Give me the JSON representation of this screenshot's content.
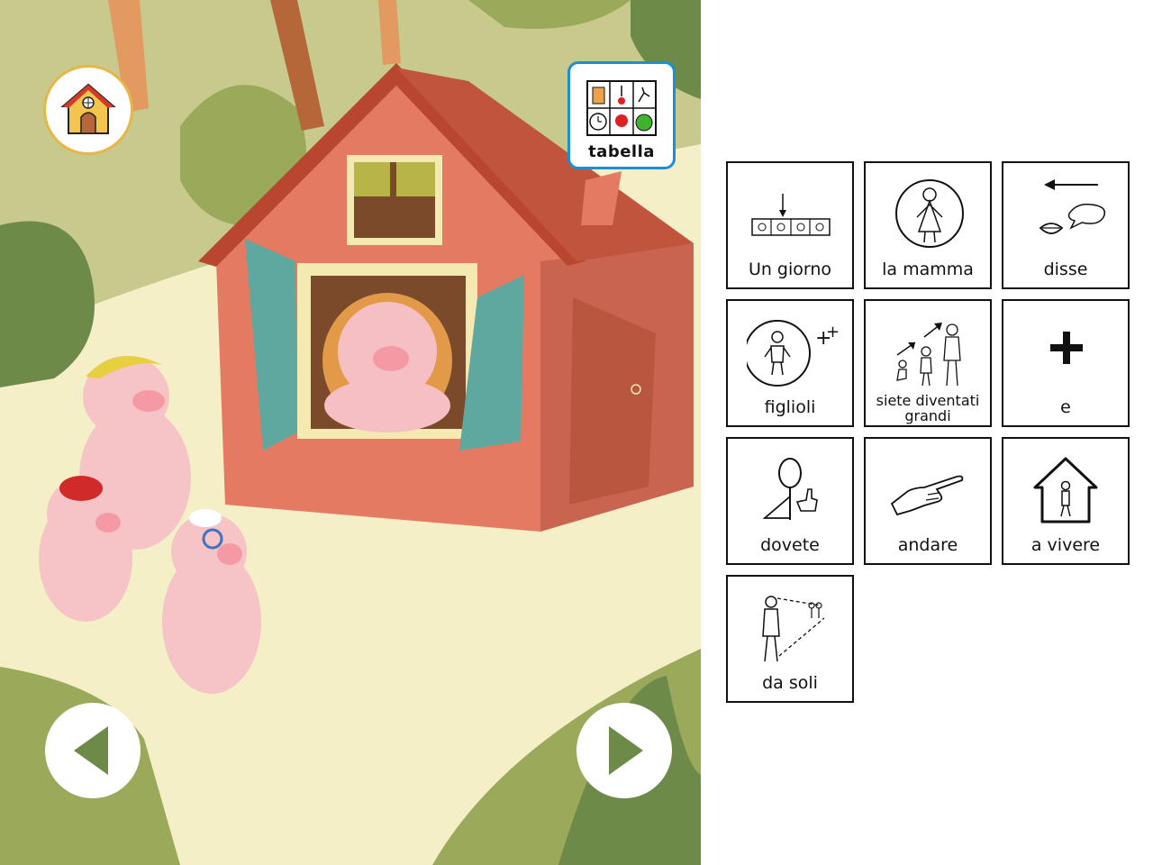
{
  "scene": {
    "home_button": {
      "icon": "house-icon"
    },
    "tabella_button": {
      "label": "tabella",
      "icon": "symbol-grid-icon",
      "border_color": "#1a8fd8"
    },
    "prev_button": {
      "icon": "arrow-left-icon"
    },
    "next_button": {
      "icon": "arrow-right-icon"
    },
    "arrow_color": "#6d8a49"
  },
  "phrase_cards": [
    {
      "label": "Un giorno",
      "icon": "day-calendar-icon"
    },
    {
      "label": "la mamma",
      "icon": "mother-icon"
    },
    {
      "label": "disse",
      "icon": "said-speech-icon"
    },
    {
      "label": "figlioli",
      "icon": "children-icon"
    },
    {
      "label": "siete diventati grandi",
      "icon": "grown-up-icon"
    },
    {
      "label": "e",
      "icon": "plus-icon"
    },
    {
      "label": "dovete",
      "icon": "must-icon"
    },
    {
      "label": "andare",
      "icon": "pointing-hand-icon"
    },
    {
      "label": "a vivere",
      "icon": "live-in-house-icon"
    },
    {
      "label": "da soli",
      "icon": "alone-icon"
    }
  ]
}
